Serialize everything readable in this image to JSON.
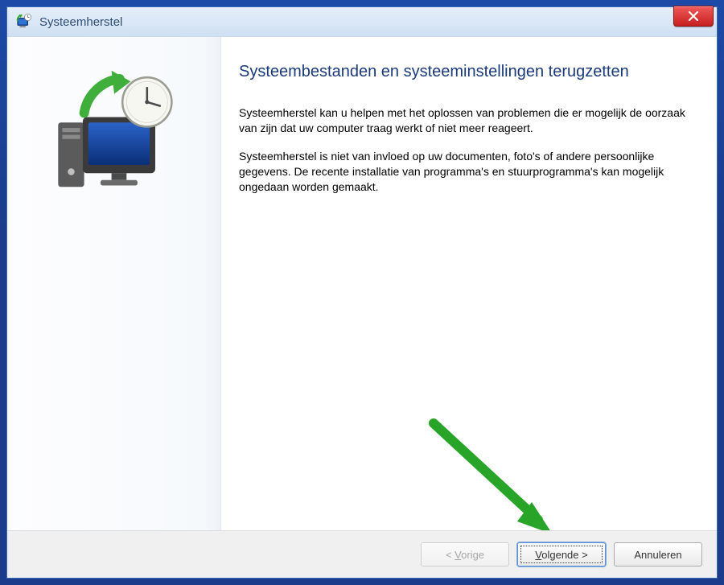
{
  "window": {
    "title": "Systeemherstel"
  },
  "content": {
    "heading": "Systeembestanden en systeeminstellingen terugzetten",
    "paragraph1": "Systeemherstel kan u helpen met het oplossen van problemen die er mogelijk de oorzaak van zijn dat uw computer traag werkt of niet meer reageert.",
    "paragraph2": "Systeemherstel is niet van invloed op uw documenten, foto's of andere persoonlijke gegevens. De recente installatie van programma's en stuurprogramma's kan mogelijk ongedaan worden gemaakt."
  },
  "buttons": {
    "back_prefix": "< ",
    "back_mnemonic": "V",
    "back_rest": "orige",
    "next_mnemonic": "V",
    "next_rest": "olgende >",
    "cancel": "Annuleren"
  }
}
